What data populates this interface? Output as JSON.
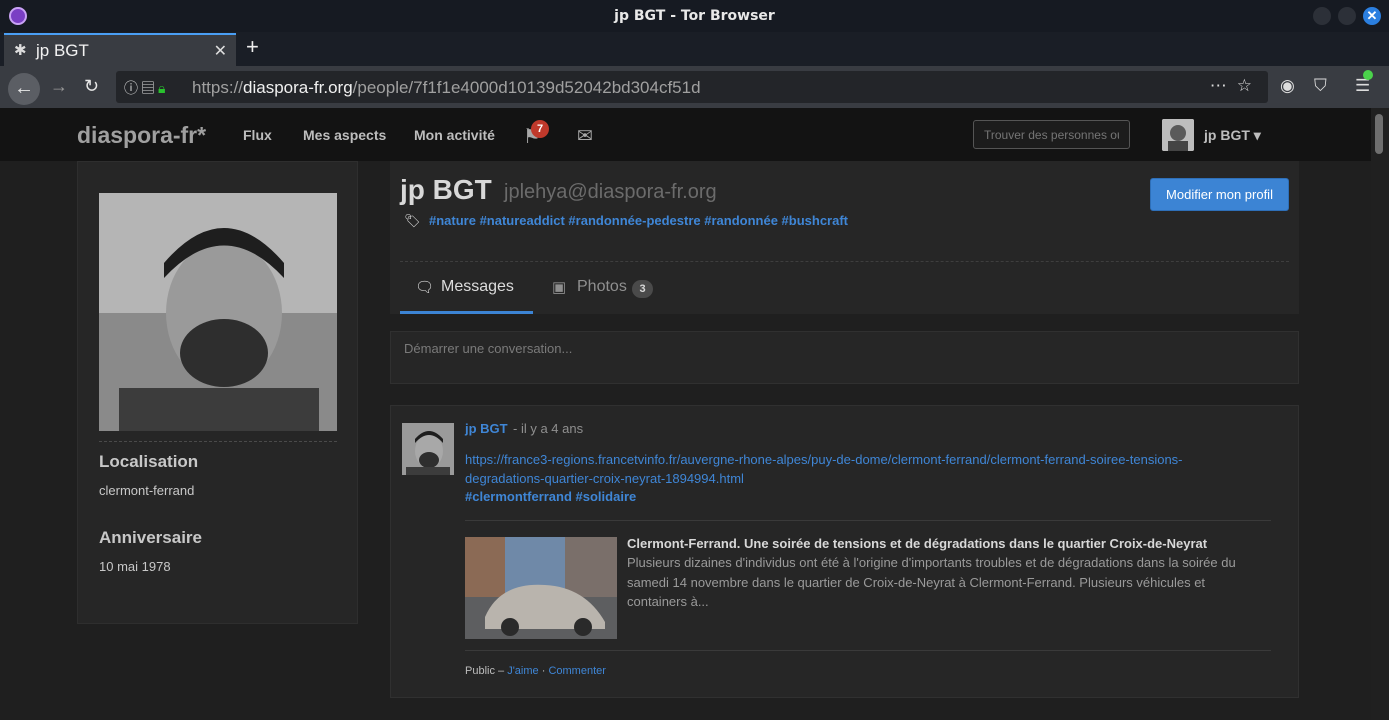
{
  "window": {
    "title": "jp BGT - Tor Browser"
  },
  "tab": {
    "title": "jp BGT",
    "close": "✕",
    "new_tab": "+"
  },
  "urlbar": {
    "prefix": "https://",
    "host": "diaspora-fr.org",
    "path": "/people/7f1f1e4000d10139d52042bd304cf51d"
  },
  "site": {
    "brand": "diaspora-fr*",
    "nav": {
      "flux": "Flux",
      "aspects": "Mes aspects",
      "activity": "Mon activité"
    },
    "notification_count": "7",
    "search_placeholder": "Trouver des personnes ou",
    "user_name": "jp BGT ▾"
  },
  "profile": {
    "name": "jp BGT",
    "handle": "jplehya@diaspora-fr.org",
    "tags": "#nature #natureaddict #randonnée-pedestre #randonnée #bushcraft",
    "edit_button": "Modifier mon profil",
    "location_label": "Localisation",
    "location_value": "clermont-ferrand",
    "birthday_label": "Anniversaire",
    "birthday_value": "10 mai 1978",
    "tabs": {
      "messages": "Messages",
      "photos": "Photos",
      "photos_count": "3"
    }
  },
  "composer": {
    "placeholder": "Démarrer une conversation..."
  },
  "post": {
    "author": "jp BGT",
    "time": "- il y a 4 ans",
    "link": "https://france3-regions.francetvinfo.fr/auvergne-rhone-alpes/puy-de-dome/clermont-ferrand/clermont-ferrand-soiree-tensions-degradations-quartier-croix-neyrat-1894994.html",
    "tags": "#clermontferrand #solidaire",
    "preview_title": "Clermont-Ferrand. Une soirée de tensions et de dégradations dans le quartier Croix-de-Neyrat",
    "preview_text": "Plusieurs dizaines d'individus ont été à l'origine d'importants troubles et de dégradations dans la soirée du samedi 14 novembre dans le quartier de Croix-de-Neyrat à Clermont-Ferrand. Plusieurs véhicules et containers à...",
    "footer_public": "Public –",
    "footer_like": "J'aime",
    "footer_dot": "·",
    "footer_comment": "Commenter"
  },
  "colors": {
    "accent": "#3c84d4",
    "link": "#3f86d6",
    "badge": "#c0392b",
    "lock": "#29c12e"
  },
  "icons": [
    "tor-browser-icon",
    "back-arrow-icon",
    "forward-arrow-icon",
    "reload-icon",
    "info-icon",
    "lock-icon",
    "more-icon",
    "bookmark-star-icon",
    "onion-icon",
    "shield-icon",
    "hamburger-menu-icon",
    "notification-icon",
    "mail-icon",
    "tag-icon",
    "messages-icon",
    "photos-icon"
  ]
}
